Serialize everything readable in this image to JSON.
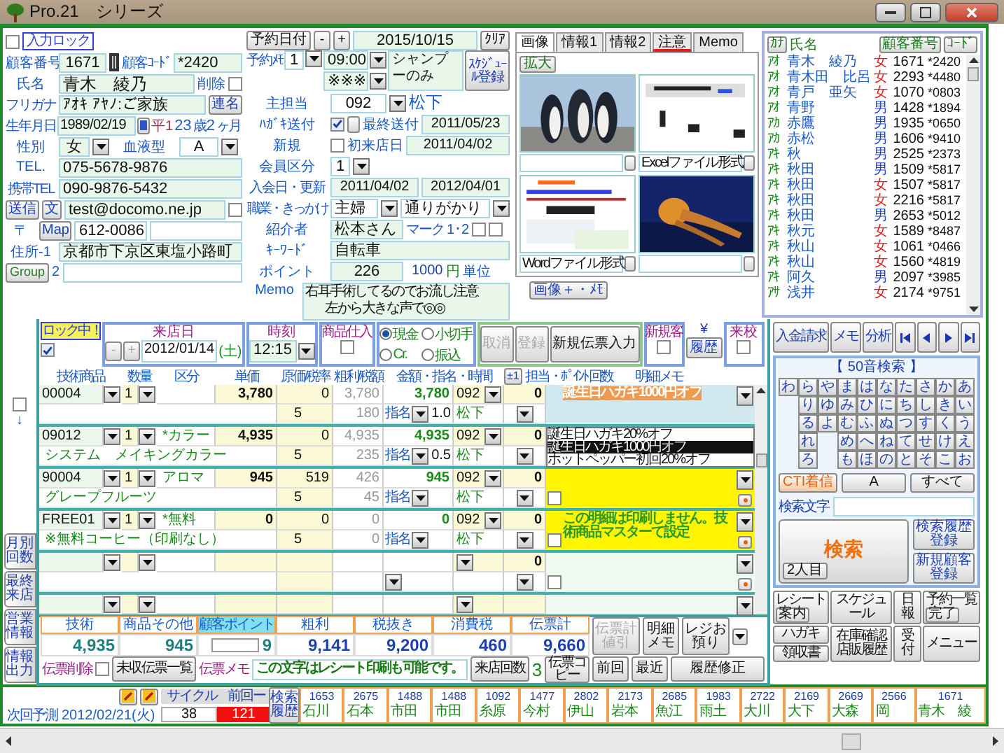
{
  "window": {
    "title": "Pro.21　シリーズ"
  },
  "input_lock": {
    "label": "入力ロック",
    "checked": false
  },
  "customer": {
    "number_label": "顧客番号",
    "number": "1671",
    "code_label": "顧客ｺｰﾄﾞ",
    "code": "*2420",
    "name_label": "氏名",
    "name": "青木　綾乃",
    "delete_label": "削除",
    "deleted": false,
    "kana_label": "フリガナ",
    "kana": "ｱｵｷ ｱﾔﾉ:ご家族",
    "joint_button": "連名",
    "birth_label": "生年月日",
    "birth": "1989/02/19",
    "era": "平1",
    "age": "23",
    "age_unit": "歳",
    "months": "2",
    "months_unit": "ヶ月",
    "sex_label": "性別",
    "sex": "女",
    "blood_label": "血液型",
    "blood": "A",
    "tel_label": "TEL.",
    "tel": "075-5678-9876",
    "mobile_label": "携帯TEL",
    "mobile": "090-9876-5432",
    "send_button": "送信",
    "text_button": "文",
    "email": "test@docomo.ne.jp",
    "email_flag": false,
    "zip_label": "〒",
    "map_button": "Map",
    "zip": "612-0086",
    "address_label": "住所-1",
    "address": "京都市下京区東塩小路町",
    "group_button": "Group",
    "address2_label": "2"
  },
  "reservation": {
    "date_button": "予約日付",
    "minus": "-",
    "plus": "+",
    "date": "2015/10/15",
    "clear_button": "ｸﾘｱ",
    "memo_label": "予約ﾒﾓ",
    "memo_no": "1",
    "time": "09:00",
    "time2": "※※※",
    "memo": "シャンプーのみ",
    "schedule_button": "ｽｹｼﾞｭｰﾙ登録"
  },
  "membership": {
    "staff_label": "主担当",
    "staff_code": "092",
    "staff_name": "松下",
    "postcard_label": "ﾊｶﾞｷ送付",
    "postcard": true,
    "last_sent_label": "最終送付",
    "last_sent": "2011/05/23",
    "new_label": "新規",
    "is_new": false,
    "first_visit_label": "初来店日",
    "first_visit": "2011/04/02",
    "class_label": "会員区分",
    "class": "1",
    "join_label": "入会日・更新",
    "join": "2011/04/02",
    "renew": "2012/04/01",
    "job_label": "職業・きっかけ",
    "job": "主婦",
    "trigger": "通りがかり",
    "referrer_label": "紹介者",
    "referrer": "松本さん",
    "mark_label": "マーク",
    "mark_nums": "1･2",
    "marks": [
      {
        "checked": false
      },
      {
        "checked": false
      }
    ],
    "keyword_label": "ｷｰﾜｰﾄﾞ",
    "keyword": "自転車",
    "point_label": "ポイント",
    "points": "226",
    "point_unit": "1000",
    "yen": "円",
    "unit": "単位",
    "memo_label": "Memo",
    "memo_lines": [
      "右耳手術してるのでお流し注意",
      "左から大きな声で◎◎"
    ]
  },
  "images": {
    "tabs": [
      {
        "label": "画像",
        "selected": true,
        "alert": false
      },
      {
        "label": "情報1",
        "selected": false,
        "alert": false
      },
      {
        "label": "情報2",
        "selected": false,
        "alert": false
      },
      {
        "label": "注意",
        "selected": false,
        "alert": true
      },
      {
        "label": "Memo",
        "selected": false,
        "alert": false
      }
    ],
    "zoom_button": "拡大",
    "items": [
      {
        "kind": "picture"
      },
      {
        "kind": "picture",
        "caption": "Excelファイル形式"
      },
      {
        "kind": "picture",
        "caption": "Wordファイル形式"
      },
      {
        "kind": "picture"
      }
    ],
    "memo_button": "画像＋・ﾒﾓ"
  },
  "customer_list": {
    "kana_button": "ｶﾅ",
    "name_label": "氏名",
    "number_button": "顧客番号",
    "code_button": "ｺｰﾄﾞ",
    "rows": [
      {
        "kana": "ｱｵ",
        "name": "青木　綾乃",
        "sex": "女",
        "color": "#e02020",
        "number": "1671",
        "code": "*2420"
      },
      {
        "kana": "ｱｵ",
        "name": "青木田　比呂",
        "sex": "女",
        "color": "#e02020",
        "number": "2293",
        "code": "*4480"
      },
      {
        "kana": "ｱｵ",
        "name": "青戸　亜矢",
        "sex": "女",
        "color": "#e02020",
        "number": "1070",
        "code": "*0803"
      },
      {
        "kana": "ｱｵ",
        "name": "青野",
        "sex": "男",
        "color": "#2040d0",
        "number": "1428",
        "code": "*1894"
      },
      {
        "kana": "ｱｶ",
        "name": "赤鷹",
        "sex": "男",
        "color": "#2040d0",
        "number": "1935",
        "code": "*0650"
      },
      {
        "kana": "ｱｶ",
        "name": "赤松",
        "sex": "男",
        "color": "#2040d0",
        "number": "1606",
        "code": "*9410"
      },
      {
        "kana": "ｱｷ",
        "name": "秋",
        "sex": "男",
        "color": "#2040d0",
        "number": "2525",
        "code": "*2373"
      },
      {
        "kana": "ｱｷ",
        "name": "秋田",
        "sex": "男",
        "color": "#2040d0",
        "number": "1509",
        "code": "*5817"
      },
      {
        "kana": "ｱｷ",
        "name": "秋田",
        "sex": "女",
        "color": "#e02020",
        "number": "1507",
        "code": "*5817"
      },
      {
        "kana": "ｱｷ",
        "name": "秋田",
        "sex": "女",
        "color": "#e02020",
        "number": "2216",
        "code": "*5817"
      },
      {
        "kana": "ｱｷ",
        "name": "秋田",
        "sex": "男",
        "color": "#2040d0",
        "number": "2653",
        "code": "*5012"
      },
      {
        "kana": "ｱｷ",
        "name": "秋元",
        "sex": "女",
        "color": "#e02020",
        "number": "1589",
        "code": "*8487"
      },
      {
        "kana": "ｱｷ",
        "name": "秋山",
        "sex": "女",
        "color": "#e02020",
        "number": "1061",
        "code": "*0466"
      },
      {
        "kana": "ｱｷ",
        "name": "秋山",
        "sex": "女",
        "color": "#e02020",
        "number": "1560",
        "code": "*4819"
      },
      {
        "kana": "ｱｷ",
        "name": "阿久",
        "sex": "男",
        "color": "#2040d0",
        "number": "2097",
        "code": "*3985"
      },
      {
        "kana": "ｱｻ",
        "name": "浅井",
        "sex": "女",
        "color": "#e02020",
        "number": "2174",
        "code": "*9751"
      }
    ]
  },
  "side_tabs": [
    "月別回数",
    "最終来店",
    "営業情報",
    "情報出力"
  ],
  "side_check": {
    "checked": false,
    "arrow": "↓"
  },
  "slip": {
    "lock_label": "ロック中！",
    "locked": true,
    "date_label": "来店日",
    "minus": "-",
    "plus": "+",
    "date": "2012/01/14",
    "weekday": "(土)",
    "time_label": "時刻",
    "time": "12:15",
    "goods_label": "商品仕入",
    "goods_checked": false,
    "payments": [
      {
        "label": "現金",
        "selected": true
      },
      {
        "label": "小切手",
        "selected": false
      },
      {
        "label": "Cr.",
        "selected": false
      },
      {
        "label": "振込",
        "selected": false
      }
    ],
    "cancel_button": {
      "label": "取消",
      "disabled": true
    },
    "register_button": {
      "label": "登録",
      "disabled": true
    },
    "new_slip_button": "新規伝票入力",
    "new_customer_label": "新規客",
    "new_customer": false,
    "history_button": "履歴",
    "yen": "¥",
    "school_label": "来校",
    "school": false,
    "columns": {
      "item": "技術商品",
      "qty": "数量",
      "category": "区分",
      "price": "単価",
      "cost": "原価/税率",
      "gross": "粗利/税額",
      "amount": "金額・指名・時間",
      "adjust_button": "±1",
      "staff": "担当・ﾎﾟｲﾝﾄ 回数",
      "memo": "明細メモ"
    },
    "items": [
      {
        "kind": "highlight",
        "code": "00004",
        "qty": "1",
        "price": "3,780",
        "cost": "0",
        "gross": "3,780",
        "amount": "3,780",
        "staff": "092",
        "count": "0",
        "tax_rate": "5",
        "tax": "180",
        "nominated": "指名",
        "hours": "1.0",
        "staff_name": "松下",
        "memo": "誕生日ハガキ1000円オフ"
      },
      {
        "kind": "list",
        "code": "09012",
        "qty": "1",
        "category": "*カラー",
        "price": "4,935",
        "cost": "0",
        "gross": "4,935",
        "amount": "4,935",
        "staff": "092",
        "count": "0",
        "name": "システム　メイキングカラー",
        "tax_rate": "5",
        "tax": "235",
        "nominated": "指名",
        "hours": "0.5",
        "staff_name": "松下",
        "options": [
          {
            "label": "誕生日ハガキ20%オフ",
            "selected": false
          },
          {
            "label": "誕生日ハガキ1000円オフ",
            "selected": true
          },
          {
            "label": "ホットペッパー初回20%オフ",
            "selected": false
          }
        ]
      },
      {
        "kind": "yellow",
        "code": "90004",
        "qty": "1",
        "category": "アロマ",
        "price": "945",
        "cost": "519",
        "gross": "426",
        "amount": "945",
        "staff": "092",
        "count": "0",
        "name": "グレープフルーツ",
        "tax_rate": "5",
        "tax": "45",
        "nominated": "指名",
        "staff_name": "松下",
        "memo_checked": false
      },
      {
        "kind": "yellow",
        "code": "FREE01",
        "qty": "1",
        "category": "*無料",
        "price": "0",
        "cost": "0",
        "gross": "0",
        "amount": "0",
        "staff": "092",
        "count": "0",
        "name": "※無料コーヒー（印刷なし）",
        "tax_rate": "5",
        "tax": "0",
        "nominated": "指名",
        "staff_name": "松下",
        "memo": "この明細は印刷しません。技術商品マスターて設定",
        "memo_checked": false
      },
      {
        "kind": "plain",
        "count": "0",
        "memo_checked": false
      },
      {
        "kind": "plain",
        "partial": true
      }
    ],
    "totals": [
      {
        "label": "技術",
        "value": "4,935"
      },
      {
        "label": "商品その他",
        "value": "945"
      },
      {
        "label": "顧客ポイント",
        "value": "9",
        "kind": "points"
      },
      {
        "label": "粗利",
        "value": "9,141"
      },
      {
        "label": "税抜き",
        "value": "9,200"
      },
      {
        "label": "消費税",
        "value": "460"
      },
      {
        "label": "伝票計",
        "value": "9,660"
      }
    ],
    "discount_button": {
      "label": "伝票計値引",
      "disabled": true
    },
    "detail_memo_button": "明細メモ",
    "deposit_button": "レジお預り",
    "delete_label": "伝票削除",
    "delete_checked": false,
    "unpaid_button": "未収伝票一覧",
    "slip_memo_label": "伝票メモ",
    "slip_memo": "この文字はレシート印刷も可能です。",
    "visits_button": "来店回数",
    "visits": "3",
    "copy_button": "伝票コピー",
    "prev_button": "前回",
    "recent_button": "最近",
    "edit_history_button": "履歴修正"
  },
  "right_panel": {
    "nav_buttons": [
      "入金請求",
      "メモ",
      "分析"
    ],
    "kana_title": "【 50音検索 】",
    "kana_columns": [
      [
        "わ"
      ],
      [
        "ら",
        "り",
        "る",
        "れ",
        "ろ"
      ],
      [
        "や",
        "ゆ",
        "よ"
      ],
      [
        "ま",
        "み",
        "む",
        "め",
        "も"
      ],
      [
        "は",
        "ひ",
        "ふ",
        "へ",
        "ほ"
      ],
      [
        "な",
        "に",
        "ぬ",
        "ね",
        "の"
      ],
      [
        "た",
        "ち",
        "つ",
        "て",
        "と"
      ],
      [
        "さ",
        "し",
        "す",
        "せ",
        "そ"
      ],
      [
        "か",
        "き",
        "く",
        "け",
        "こ"
      ],
      [
        "あ",
        "い",
        "う",
        "え",
        "お"
      ]
    ],
    "cti_button": "CTI着信",
    "a_button": "A",
    "all_button": "すべて",
    "search_label": "検索文字",
    "search_button": "検索",
    "second_button": "2人目",
    "search_history_button": "検索履歴登録",
    "new_customer_button": "新規顧客登録",
    "receipt_button": "レシート",
    "guide_button": "案内",
    "schedule_button": "スケジュール",
    "daily_button": "日報",
    "reservations_button": "予約一覧",
    "done_button": "完了",
    "postcard_button": "ハガキ",
    "invoice_button": "領収書",
    "stock_button": "在庫確認店販履歴",
    "reception_button": "受付",
    "menu_button": "メニュー"
  },
  "footer": {
    "next_label": "次回予測",
    "next_date": "2012/02/21(火)",
    "cycle_label": "サイクル",
    "cycle": "38",
    "since_label": "前回ー",
    "since": "121",
    "search_history_button": "検索履歴",
    "history": [
      {
        "number": "1653",
        "name": "石川"
      },
      {
        "number": "2675",
        "name": "石本"
      },
      {
        "number": "1488",
        "name": "市田"
      },
      {
        "number": "1488",
        "name": "市田"
      },
      {
        "number": "1092",
        "name": "糸原"
      },
      {
        "number": "1477",
        "name": "今村"
      },
      {
        "number": "2802",
        "name": "伊山"
      },
      {
        "number": "2173",
        "name": "岩本"
      },
      {
        "number": "2685",
        "name": "魚江"
      },
      {
        "number": "1983",
        "name": "雨土"
      },
      {
        "number": "2722",
        "name": "大川"
      },
      {
        "number": "2169",
        "name": "大下"
      },
      {
        "number": "2669",
        "name": "大森"
      },
      {
        "number": "2566",
        "name": "岡"
      },
      {
        "number": "1671",
        "name": "青木　綾"
      }
    ]
  }
}
